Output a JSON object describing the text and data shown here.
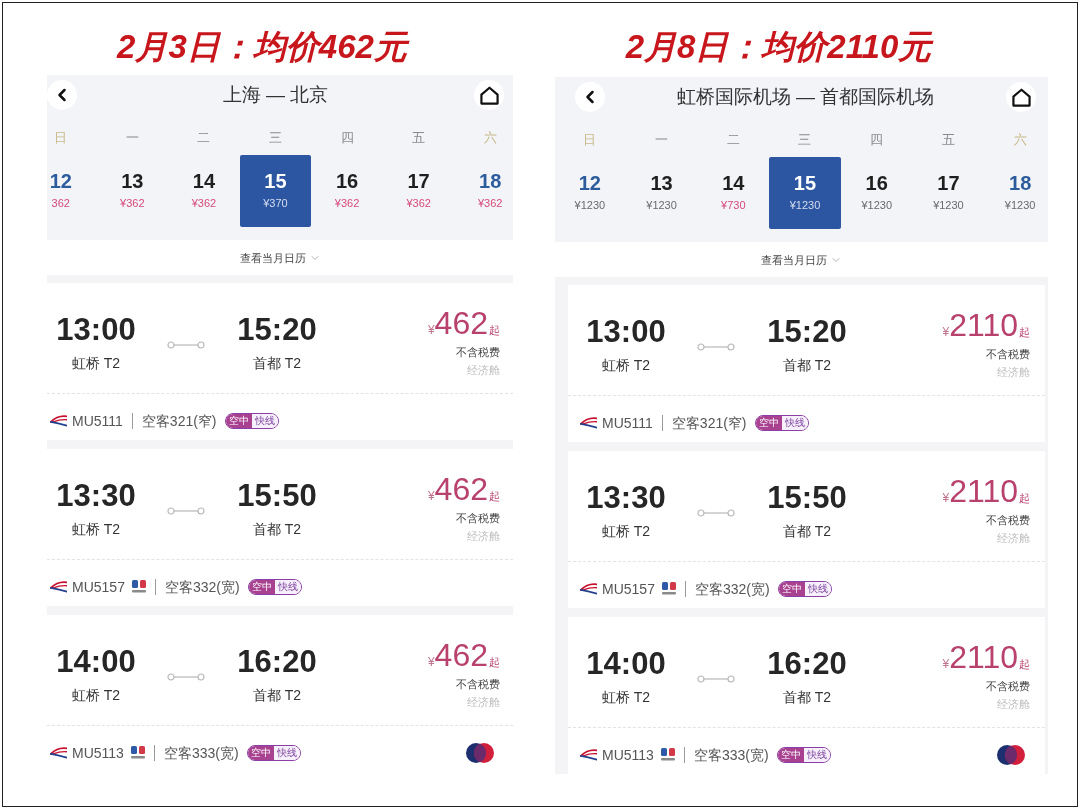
{
  "panels": [
    {
      "title": "2月3日：均价462元",
      "route": "上海 — 北京",
      "days": [
        {
          "weekday": "日",
          "date": "12",
          "price": "362",
          "weekend": true,
          "price_highlighted": true,
          "selected": false
        },
        {
          "weekday": "一",
          "date": "13",
          "price": "¥362",
          "weekend": false,
          "price_highlighted": true,
          "selected": false
        },
        {
          "weekday": "二",
          "date": "14",
          "price": "¥362",
          "weekend": false,
          "price_highlighted": true,
          "selected": false
        },
        {
          "weekday": "三",
          "date": "15",
          "price": "¥370",
          "weekend": false,
          "price_highlighted": false,
          "selected": true
        },
        {
          "weekday": "四",
          "date": "16",
          "price": "¥362",
          "weekend": false,
          "price_highlighted": true,
          "selected": false
        },
        {
          "weekday": "五",
          "date": "17",
          "price": "¥362",
          "weekend": false,
          "price_highlighted": true,
          "selected": false
        },
        {
          "weekday": "六",
          "date": "18",
          "price": "¥362",
          "weekend": true,
          "price_highlighted": true,
          "selected": false
        }
      ],
      "calendar_link": "查看当月日历",
      "flights": [
        {
          "depart_time": "13:00",
          "depart_airport": "虹桥 T2",
          "arrive_time": "15:20",
          "arrive_airport": "首都 T2",
          "currency": "¥",
          "fare": "462",
          "fare_suffix": "起",
          "tax_note": "不含税费",
          "cabin": "经济舱",
          "flight_no": "MU5111",
          "codeshare": false,
          "aircraft": "空客321(窄)",
          "tag": [
            "空中",
            "快线"
          ],
          "member_mark": false
        },
        {
          "depart_time": "13:30",
          "depart_airport": "虹桥 T2",
          "arrive_time": "15:50",
          "arrive_airport": "首都 T2",
          "currency": "¥",
          "fare": "462",
          "fare_suffix": "起",
          "tax_note": "不含税费",
          "cabin": "经济舱",
          "flight_no": "MU5157",
          "codeshare": true,
          "aircraft": "空客332(宽)",
          "tag": [
            "空中",
            "快线"
          ],
          "member_mark": false
        },
        {
          "depart_time": "14:00",
          "depart_airport": "虹桥 T2",
          "arrive_time": "16:20",
          "arrive_airport": "首都 T2",
          "currency": "¥",
          "fare": "462",
          "fare_suffix": "起",
          "tax_note": "不含税费",
          "cabin": "经济舱",
          "flight_no": "MU5113",
          "codeshare": true,
          "aircraft": "空客333(宽)",
          "tag": [
            "空中",
            "快线"
          ],
          "member_mark": true
        }
      ]
    },
    {
      "title": "2月8日：均价2110元",
      "route": "虹桥国际机场 — 首都国际机场",
      "days": [
        {
          "weekday": "日",
          "date": "12",
          "price": "¥1230",
          "weekend": true,
          "price_highlighted": false,
          "selected": false
        },
        {
          "weekday": "一",
          "date": "13",
          "price": "¥1230",
          "weekend": false,
          "price_highlighted": false,
          "selected": false
        },
        {
          "weekday": "二",
          "date": "14",
          "price": "¥730",
          "weekend": false,
          "price_highlighted": true,
          "selected": false
        },
        {
          "weekday": "三",
          "date": "15",
          "price": "¥1230",
          "weekend": false,
          "price_highlighted": false,
          "selected": true
        },
        {
          "weekday": "四",
          "date": "16",
          "price": "¥1230",
          "weekend": false,
          "price_highlighted": false,
          "selected": false
        },
        {
          "weekday": "五",
          "date": "17",
          "price": "¥1230",
          "weekend": false,
          "price_highlighted": false,
          "selected": false
        },
        {
          "weekday": "六",
          "date": "18",
          "price": "¥1230",
          "weekend": true,
          "price_highlighted": false,
          "selected": false
        }
      ],
      "calendar_link": "查看当月日历",
      "flights": [
        {
          "depart_time": "13:00",
          "depart_airport": "虹桥 T2",
          "arrive_time": "15:20",
          "arrive_airport": "首都 T2",
          "currency": "¥",
          "fare": "2110",
          "fare_suffix": "起",
          "tax_note": "不含税费",
          "cabin": "经济舱",
          "flight_no": "MU5111",
          "codeshare": false,
          "aircraft": "空客321(窄)",
          "tag": [
            "空中",
            "快线"
          ],
          "member_mark": false
        },
        {
          "depart_time": "13:30",
          "depart_airport": "虹桥 T2",
          "arrive_time": "15:50",
          "arrive_airport": "首都 T2",
          "currency": "¥",
          "fare": "2110",
          "fare_suffix": "起",
          "tax_note": "不含税费",
          "cabin": "经济舱",
          "flight_no": "MU5157",
          "codeshare": true,
          "aircraft": "空客332(宽)",
          "tag": [
            "空中",
            "快线"
          ],
          "member_mark": false
        },
        {
          "depart_time": "14:00",
          "depart_airport": "虹桥 T2",
          "arrive_time": "16:20",
          "arrive_airport": "首都 T2",
          "currency": "¥",
          "fare": "2110",
          "fare_suffix": "起",
          "tax_note": "不含税费",
          "cabin": "经济舱",
          "flight_no": "MU5113",
          "codeshare": true,
          "aircraft": "空客333(宽)",
          "tag": [
            "空中",
            "快线"
          ],
          "member_mark": true
        }
      ]
    }
  ]
}
